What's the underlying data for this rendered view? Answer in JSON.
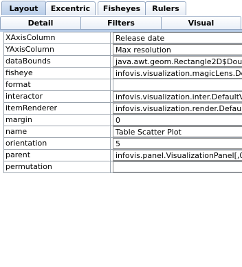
{
  "tabs_top": [
    {
      "label": "Layout",
      "selected": true
    },
    {
      "label": "Excentric",
      "selected": false
    },
    {
      "label": "Fisheyes",
      "selected": false
    },
    {
      "label": "Rulers",
      "selected": false
    }
  ],
  "tabs_second": [
    {
      "label": "Detail",
      "selected": false
    },
    {
      "label": "Filters",
      "selected": false
    },
    {
      "label": "Visual",
      "selected": false
    }
  ],
  "properties": [
    {
      "name": "XAxisColumn",
      "value": "Release date"
    },
    {
      "name": "YAxisColumn",
      "value": "Max resolution"
    },
    {
      "name": "dataBounds",
      "value": "java.awt.geom.Rectangle2D$Dou"
    },
    {
      "name": "fisheye",
      "value": "infovis.visualization.magicLens.De"
    },
    {
      "name": "format",
      "value": ""
    },
    {
      "name": "interactor",
      "value": "infovis.visualization.inter.DefaultVi"
    },
    {
      "name": "itemRenderer",
      "value": "infovis.visualization.render.Default"
    },
    {
      "name": "margin",
      "value": "0"
    },
    {
      "name": "name",
      "value": "Table Scatter Plot"
    },
    {
      "name": "orientation",
      "value": "5"
    },
    {
      "name": "parent",
      "value": "infovis.panel.VisualizationPanel[,0"
    },
    {
      "name": "permutation",
      "value": ""
    }
  ]
}
